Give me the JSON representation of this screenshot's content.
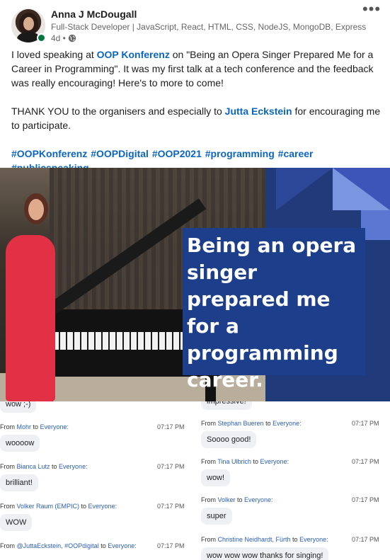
{
  "author": {
    "name": "Anna J McDougall",
    "headline": "Full-Stack Developer | JavaScript, React, HTML, CSS, NodeJS, MongoDB, Express",
    "timestamp": "4d •",
    "visibility_icon": "globe-icon",
    "online_status": "online"
  },
  "post": {
    "para1_before": "I loved speaking at ",
    "para1_link": "OOP Konferenz",
    "para1_after": " on \"Being an Opera Singer Prepared Me for a Career in Programming\". It was my first talk at a tech conference and the feedback was really encouraging! Here's to more to come!",
    "para2_before": "THANK YOU to the organisers and especially to ",
    "para2_link": "Jutta Eckstein",
    "para2_after": " for encouraging me to participate.",
    "hashtags": "#OOPKonferenz #OOPDigital #OOP2021 #programming #career #publicspeaking"
  },
  "image": {
    "slide_text": "Being an opera singer prepared me for a programming career."
  },
  "chat": {
    "left": [
      {
        "from": "",
        "to": "",
        "time": "",
        "message": "wow ;-)"
      },
      {
        "from": "Mohr",
        "to": "Everyone:",
        "time": "07:17 PM",
        "message": "woooow"
      },
      {
        "from": "Bianca Lutz",
        "to": "Everyone:",
        "time": "07:17 PM",
        "message": "brilliant!"
      },
      {
        "from": "Volker Raum (EMPIC)",
        "to": "Everyone:",
        "time": "07:17 PM",
        "message": "WOW"
      },
      {
        "from": "@JuttaEckstein, #OOPdigital",
        "to": "Everyone:",
        "time": "07:17 PM",
        "message": ""
      }
    ],
    "right": [
      {
        "from": "",
        "to": "",
        "time": "",
        "message": "impressive!"
      },
      {
        "from": "Stephan Bueren",
        "to": "Everyone:",
        "time": "07:17 PM",
        "message": "Soooo good!"
      },
      {
        "from": "Tina Ulbrich",
        "to": "Everyone:",
        "time": "07:17 PM",
        "message": "wow!"
      },
      {
        "from": "Volker",
        "to": "Everyone:",
        "time": "07:17 PM",
        "message": "super"
      },
      {
        "from": "Christine Neidhardt, Fürth",
        "to": "Everyone:",
        "time": "07:17 PM",
        "message": "wow wow wow thanks for singing!"
      }
    ],
    "from_word": "From",
    "to_word": "to"
  },
  "colors": {
    "link": "#0a66c2",
    "slide_blue": "#1d3e8a",
    "dress_red": "#e23145"
  }
}
